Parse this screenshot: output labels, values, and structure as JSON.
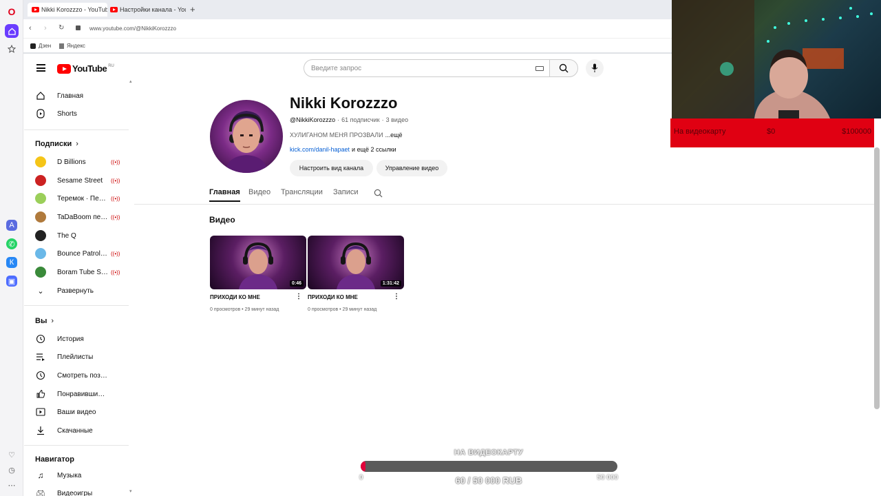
{
  "browser": {
    "tabs": [
      {
        "label": "Nikki Korozzzo - YouTube",
        "active": true
      },
      {
        "label": "Настройки канала - YouT",
        "active": false
      }
    ],
    "new_tab_symbol": "+",
    "url": "www.youtube.com/@NikkiKorozzzo",
    "bookmarks": [
      "Дзен",
      "Яндекс"
    ]
  },
  "youtube": {
    "logo_text": "YouTube",
    "logo_region": "RU",
    "search_placeholder": "Введите запрос",
    "sidebar": {
      "main": [
        {
          "label": "Главная",
          "icon": "home-icon"
        },
        {
          "label": "Shorts",
          "icon": "shorts-icon"
        }
      ],
      "subscriptions_header": "Подписки",
      "subscriptions": [
        {
          "label": "D Billions",
          "color": "#f5c518"
        },
        {
          "label": "Sesame Street",
          "color": "#cc2222"
        },
        {
          "label": "Теремок · Песе...",
          "color": "#9bcf5a"
        },
        {
          "label": "TaDaBoom песе...",
          "color": "#b07a3c"
        },
        {
          "label": "The Q",
          "color": "#222222"
        },
        {
          "label": "Bounce Patrol - ...",
          "color": "#6ab8e8"
        },
        {
          "label": "Boram Tube Stor...",
          "color": "#3a8a3a"
        }
      ],
      "expand_label": "Развернуть",
      "you_header": "Вы",
      "you_items": [
        {
          "label": "История",
          "icon": "history-icon"
        },
        {
          "label": "Плейлисты",
          "icon": "playlists-icon"
        },
        {
          "label": "Смотреть позже",
          "icon": "watch-later-icon"
        },
        {
          "label": "Понравившиеся",
          "icon": "like-icon"
        },
        {
          "label": "Ваши видео",
          "icon": "your-videos-icon"
        },
        {
          "label": "Скачанные",
          "icon": "download-icon"
        }
      ],
      "navigator_header": "Навигатор",
      "navigator_items": [
        {
          "label": "Музыка",
          "icon": "music-icon"
        },
        {
          "label": "Видеоигры",
          "icon": "gaming-icon"
        }
      ]
    },
    "channel": {
      "name": "Nikki Korozzzo",
      "handle": "@NikkiKorozzzo",
      "subscribers": "61 подписчик",
      "videos_count": "3 видео",
      "description": "ХУЛИГАНОМ МЕНЯ ПРОЗВАЛИ",
      "more": "...ещё",
      "link": "kick.com/danil-hapaet",
      "more_links": "и ещё 2 ссылки",
      "customize_label": "Настроить вид канала",
      "manage_label": "Управление видео"
    },
    "tabs": [
      "Главная",
      "Видео",
      "Трансляции",
      "Записи"
    ],
    "section_title": "Видео",
    "videos": [
      {
        "title": "ПРИХОДИ КО МНЕ",
        "duration": "0:46",
        "views": "0 просмотров",
        "age": "29 минут назад"
      },
      {
        "title": "ПРИХОДИ КО МНЕ",
        "duration": "1:31:42",
        "views": "0 просмотров",
        "age": "29 минут назад"
      }
    ]
  },
  "overlay": {
    "donate_title": "На видеокарту",
    "donate_current": "$0",
    "donate_goal": "$100000",
    "goal_label": "НА ВИДЕОКАРТУ",
    "goal_min": "0",
    "goal_max": "50 000",
    "goal_value": "60 / 50 000 RUB",
    "goal_fraction": 0.0012
  },
  "colors": {
    "yt_red": "#ff0000",
    "link": "#065fd4",
    "donate_bg": "#e00012"
  }
}
